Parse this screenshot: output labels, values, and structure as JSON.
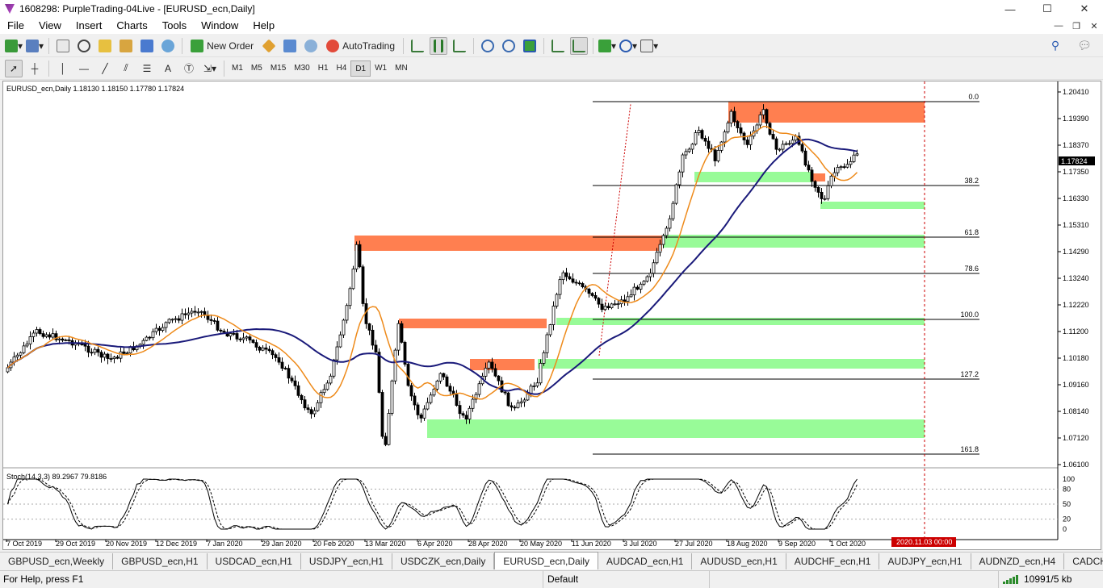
{
  "window": {
    "title": "1608298: PurpleTrading-04Live - [EURUSD_ecn,Daily]",
    "min": "—",
    "max": "☐",
    "close": "✕"
  },
  "menu": {
    "items": [
      "File",
      "View",
      "Insert",
      "Charts",
      "Tools",
      "Window",
      "Help"
    ]
  },
  "toolbar": {
    "new_order": "New Order",
    "autotrading": "AutoTrading"
  },
  "timeframes": [
    "M1",
    "M5",
    "M15",
    "M30",
    "H1",
    "H4",
    "D1",
    "W1",
    "MN"
  ],
  "active_timeframe": "D1",
  "chart": {
    "header": "EURUSD_ecn,Daily  1.18130 1.18150 1.17780 1.17824",
    "price_labels": [
      "1.20410",
      "1.19390",
      "1.18370",
      "1.17350",
      "1.16330",
      "1.15310",
      "1.14290",
      "1.13240",
      "1.12220",
      "1.11200",
      "1.10180",
      "1.09160",
      "1.08140",
      "1.07120",
      "1.06100"
    ],
    "current_price": "1.17824",
    "fib_labels": [
      "0.0",
      "38.2",
      "61.8",
      "78.6",
      "100.0",
      "127.2",
      "161.8"
    ],
    "date_labels": [
      "7 Oct 2019",
      "29 Oct 2019",
      "20 Nov 2019",
      "12 Dec 2019",
      "7 Jan 2020",
      "29 Jan 2020",
      "20 Feb 2020",
      "13 Mar 2020",
      "6 Apr 2020",
      "28 Apr 2020",
      "20 May 2020",
      "11 Jun 2020",
      "3 Jul 2020",
      "27 Jul 2020",
      "18 Aug 2020",
      "9 Sep 2020",
      "1 Oct 2020"
    ],
    "date_marker": "2020.11.03 00:00",
    "stoch_header": "Stoch(14,3,3) 89.2967 79.8186",
    "stoch_levels": [
      "100",
      "80",
      "50",
      "20",
      "0"
    ],
    "colors": {
      "supply": "#ff7f50",
      "demand": "#98fb98",
      "ma_fast": "#ee8a1a",
      "ma_slow": "#1a1a7a",
      "marker": "#cc0000"
    }
  },
  "tabs": [
    "GBPUSD_ecn,Weekly",
    "GBPUSD_ecn,H1",
    "USDCAD_ecn,H1",
    "USDJPY_ecn,H1",
    "USDCZK_ecn,Daily",
    "EURUSD_ecn,Daily",
    "AUDCAD_ecn,H1",
    "AUDUSD_ecn,H1",
    "AUDCHF_ecn,H1",
    "AUDJPY_ecn,H1",
    "AUDNZD_ecn,H4",
    "CADCHF_e"
  ],
  "active_tab": "EURUSD_ecn,Daily",
  "status": {
    "help": "For Help, press F1",
    "profile": "Default",
    "traffic": "10991/5 kb"
  }
}
